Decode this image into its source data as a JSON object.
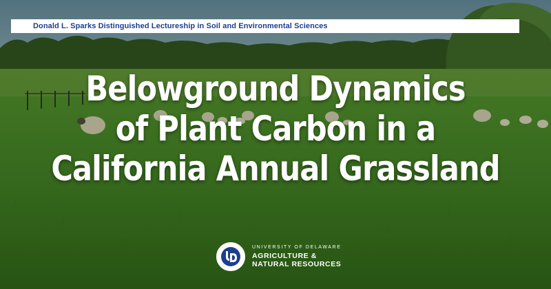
{
  "banner": {
    "text": "Donald L. Sparks Distinguished Lectureship in Soil and Environmental Sciences",
    "color": "#1c3f8c"
  },
  "title": {
    "lines": [
      "Belowground Dynamics",
      "of Plant Carbon in a",
      "California Annual Grassland"
    ]
  },
  "logo": {
    "icon": "university-of-delaware-ud-logo",
    "university": "UNIVERSITY OF DELAWARE",
    "department_line1": "AGRICULTURE &",
    "department_line2": "NATURAL RESOURCES"
  },
  "background": {
    "sky": "#6a8aa0",
    "trees": "#2c4a1c",
    "field": "#3f7a22",
    "field_dark": "#2f5f18"
  }
}
